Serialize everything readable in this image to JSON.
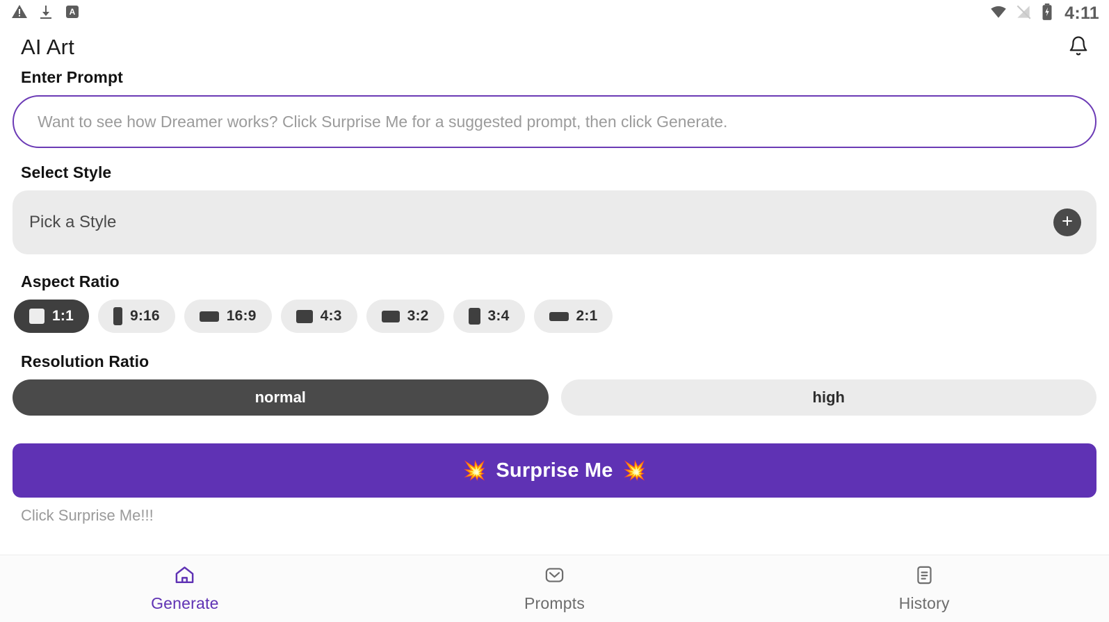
{
  "status_bar": {
    "icons": [
      "warning-triangle-icon",
      "download-icon",
      "app-badge-icon"
    ],
    "right_icons": [
      "wifi-icon",
      "signal-off-icon",
      "battery-charging-icon"
    ],
    "time": "4:11"
  },
  "header": {
    "title": "AI Art",
    "notification_icon": "bell-icon"
  },
  "prompt": {
    "label": "Enter Prompt",
    "value": "",
    "placeholder": "Want to see how Dreamer works? Click Surprise Me for a suggested prompt, then click Generate."
  },
  "style": {
    "label": "Select Style",
    "placeholder": "Pick a Style",
    "add_icon": "plus-icon"
  },
  "aspect_ratio": {
    "label": "Aspect Ratio",
    "selected": "1:1",
    "options": [
      {
        "label": "1:1",
        "glyph": "g-1-1",
        "selected": true
      },
      {
        "label": "9:16",
        "glyph": "g-9-16",
        "selected": false
      },
      {
        "label": "16:9",
        "glyph": "g-16-9",
        "selected": false
      },
      {
        "label": "4:3",
        "glyph": "g-4-3",
        "selected": false
      },
      {
        "label": "3:2",
        "glyph": "g-3-2",
        "selected": false
      },
      {
        "label": "3:4",
        "glyph": "g-3-4",
        "selected": false
      },
      {
        "label": "2:1",
        "glyph": "g-2-1",
        "selected": false
      }
    ]
  },
  "resolution": {
    "label": "Resolution Ratio",
    "selected": "normal",
    "options": [
      {
        "label": "normal",
        "selected": true
      },
      {
        "label": "high",
        "selected": false
      }
    ]
  },
  "surprise": {
    "emoji_left": "💥",
    "text": "Surprise Me",
    "emoji_right": "💥",
    "status_note": "Click Surprise Me!!!"
  },
  "bottom_nav": {
    "items": [
      {
        "label": "Generate",
        "icon": "home-icon",
        "active": true
      },
      {
        "label": "Prompts",
        "icon": "envelope-icon",
        "active": false
      },
      {
        "label": "History",
        "icon": "document-icon",
        "active": false
      }
    ]
  },
  "colors": {
    "accent": "#5f32b4",
    "input_border": "#6b3ab5",
    "chip_selected": "#3f3f3f",
    "chip_idle": "#ebebeb"
  }
}
